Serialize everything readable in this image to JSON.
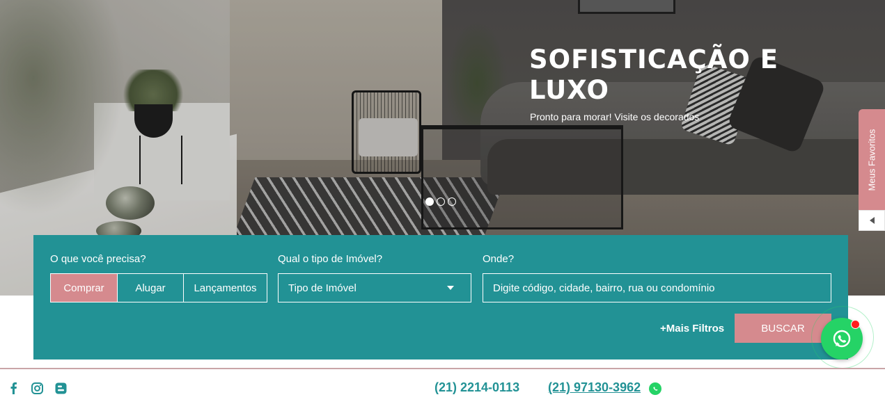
{
  "hero": {
    "title": "SOFISTICAÇÃO E LUXO",
    "subtitle": "Pronto para morar! Visite os decorados",
    "slides_total": 3,
    "slide_active": 1
  },
  "favorites_tab": {
    "label": "Meus Favoritos"
  },
  "search": {
    "need_label": "O que você precisa?",
    "need_options": [
      "Comprar",
      "Alugar",
      "Lançamentos"
    ],
    "need_selected": "Comprar",
    "type_label": "Qual o tipo de Imóvel?",
    "type_value": "Tipo de Imóvel",
    "where_label": "Onde?",
    "where_placeholder": "Digite código, cidade, bairro, rua ou condomínio",
    "more_filters": "+Mais Filtros",
    "search_button": "BUSCAR"
  },
  "footer": {
    "social_icons": [
      "facebook-icon",
      "instagram-icon",
      "blogger-icon"
    ],
    "phone": "(21) 2214-0113",
    "whatsapp_phone": "(21) 97130-3962"
  },
  "colors": {
    "teal": "#229295",
    "rose": "#d58a8e",
    "whatsapp": "#25d366",
    "badge": "#ff1d1d"
  }
}
